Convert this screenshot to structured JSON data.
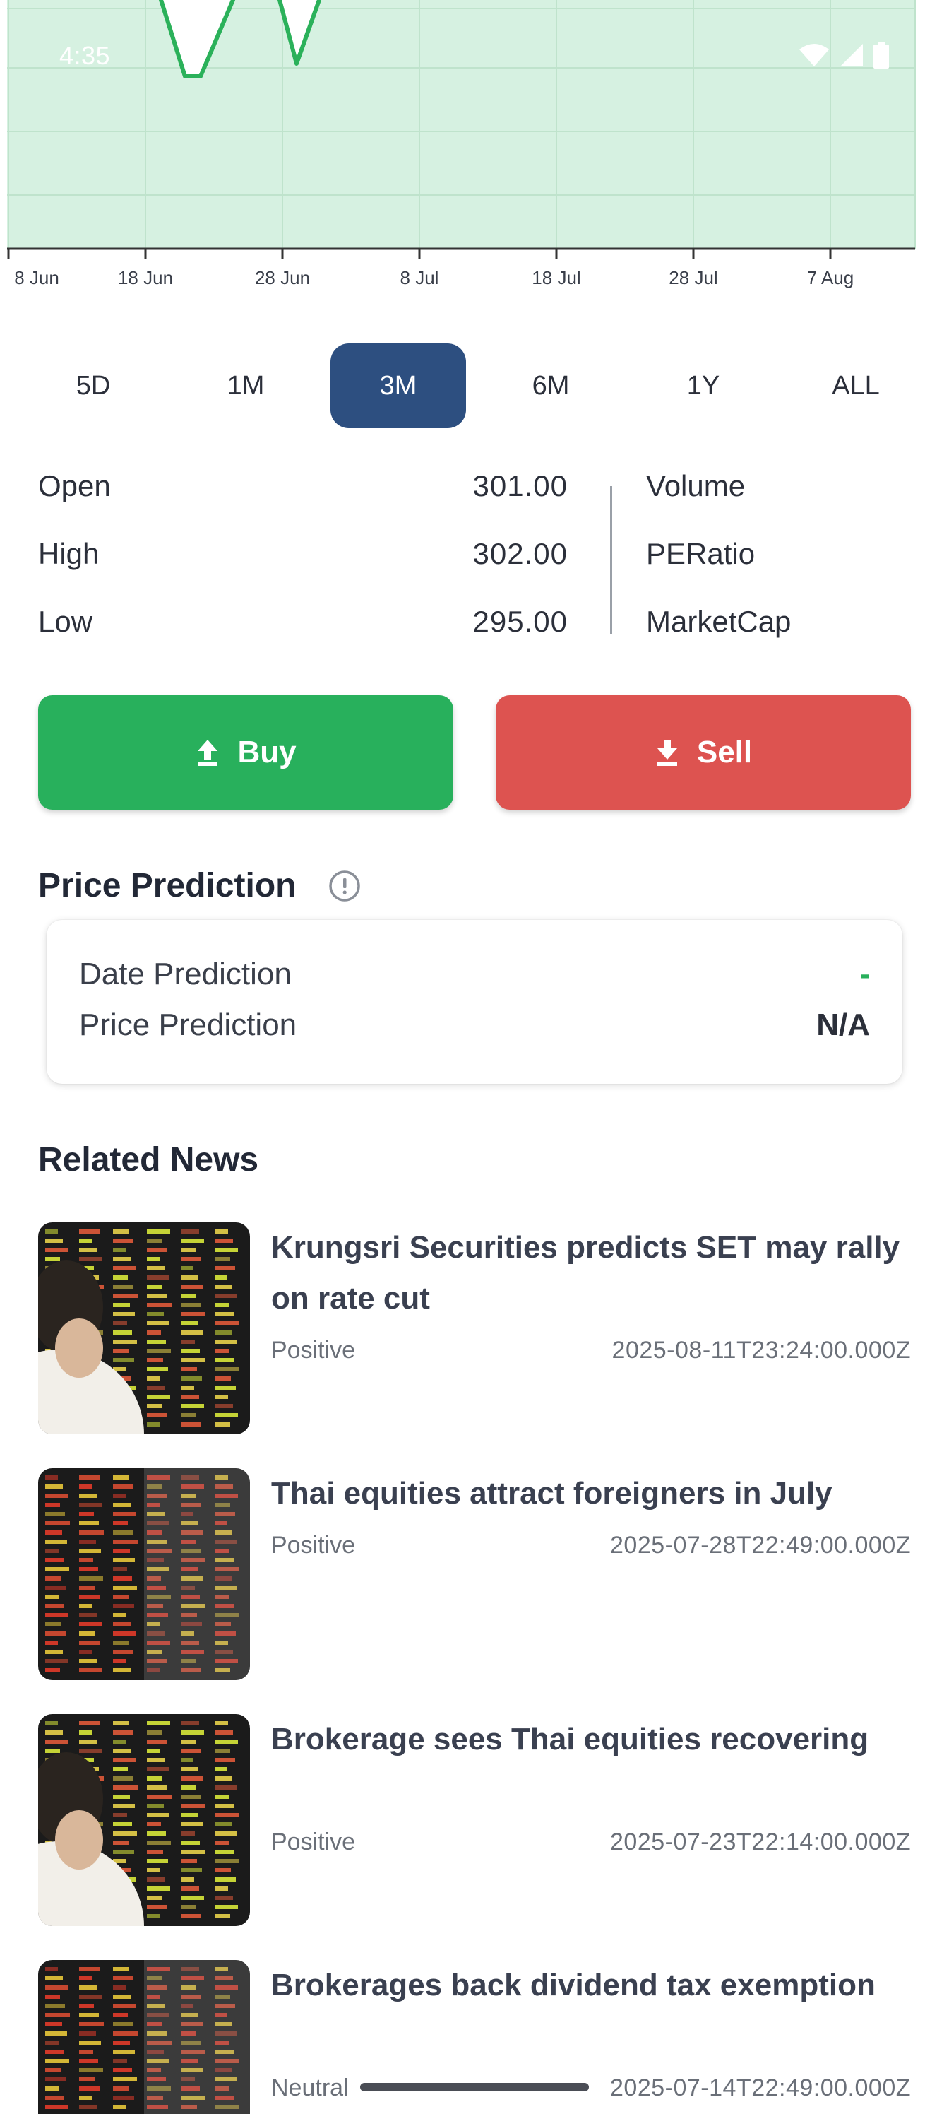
{
  "status_bar": {
    "time": "4:35"
  },
  "chart_data": {
    "type": "area",
    "x_tick_labels": [
      "8 Jun",
      "18 Jun",
      "28 Jun",
      "8 Jul",
      "18 Jul",
      "28 Jul",
      "7 Aug"
    ],
    "grid": true,
    "colors": {
      "fill": "#d6f1e1",
      "line": "#2bb15a",
      "grid": "#bfe3cc",
      "axis": "#333333"
    }
  },
  "range_tabs": [
    {
      "label": "5D"
    },
    {
      "label": "1M"
    },
    {
      "label": "3M",
      "active": true
    },
    {
      "label": "6M"
    },
    {
      "label": "1Y"
    },
    {
      "label": "ALL"
    }
  ],
  "stats": {
    "open_label": "Open",
    "open_value": "301.00",
    "high_label": "High",
    "high_value": "302.00",
    "low_label": "Low",
    "low_value": "295.00",
    "volume_label": "Volume",
    "pe_label": "PERatio",
    "marketcap_label": "MarketCap"
  },
  "actions": {
    "buy_label": "Buy",
    "sell_label": "Sell",
    "buy_color": "#28b05c",
    "sell_color": "#dd5350"
  },
  "prediction": {
    "title": "Price Prediction",
    "date_label": "Date Prediction",
    "date_value": "-",
    "price_label": "Price Prediction",
    "price_value": "N/A"
  },
  "news": {
    "title": "Related News",
    "items": [
      {
        "title": "Krungsri Securities predicts SET may rally on rate cut",
        "sentiment": "Positive",
        "date": "2025-08-11T23:24:00.000Z",
        "thumb": "trader"
      },
      {
        "title": "Thai equities attract foreigners in July",
        "sentiment": "Positive",
        "date": "2025-07-28T22:49:00.000Z",
        "thumb": "board"
      },
      {
        "title": "Brokerage sees Thai equities recovering",
        "sentiment": "Positive",
        "date": "2025-07-23T22:14:00.000Z",
        "thumb": "trader"
      },
      {
        "title": "Brokerages back dividend tax exemption",
        "sentiment": "Neutral",
        "date": "2025-07-14T22:49:00.000Z",
        "thumb": "board"
      }
    ]
  }
}
